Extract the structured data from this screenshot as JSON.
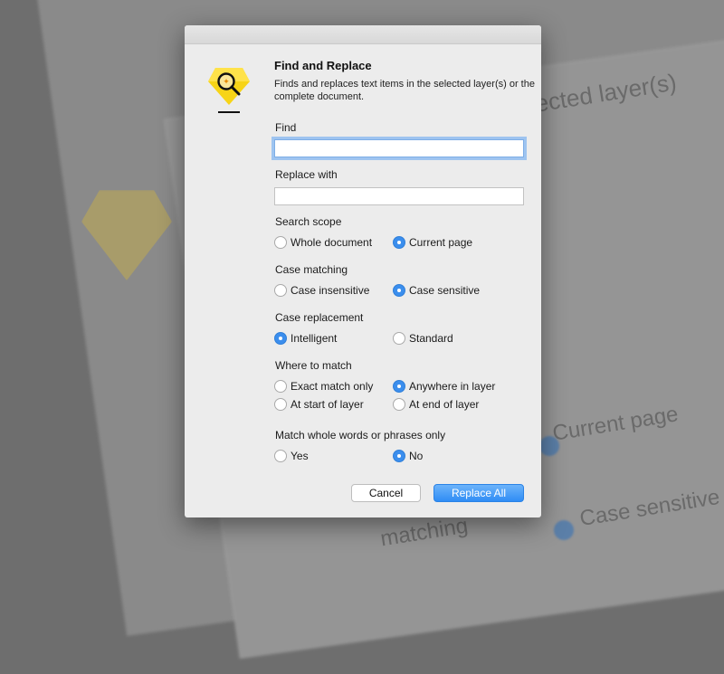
{
  "dialog": {
    "title": "Find and Replace",
    "description": "Finds and replaces text items in the selected layer(s) or the complete document.",
    "icon": "find-replace-gem-icon"
  },
  "find": {
    "label": "Find",
    "value": "",
    "placeholder": ""
  },
  "replace": {
    "label": "Replace with",
    "value": "",
    "placeholder": ""
  },
  "search_scope": {
    "label": "Search scope",
    "options": [
      "Whole document",
      "Current page"
    ],
    "selected": "Current page"
  },
  "case_matching": {
    "label": "Case matching",
    "options": [
      "Case insensitive",
      "Case sensitive"
    ],
    "selected": "Case sensitive"
  },
  "case_replacement": {
    "label": "Case replacement",
    "options": [
      "Intelligent",
      "Standard"
    ],
    "selected": "Intelligent"
  },
  "where_to_match": {
    "label": "Where to match",
    "options": [
      "Exact match only",
      "Anywhere in layer",
      "At start of layer",
      "At end of layer"
    ],
    "selected": "Anywhere in layer"
  },
  "whole_words": {
    "label": "Match whole words or phrases only",
    "options": [
      "Yes",
      "No"
    ],
    "selected": "No"
  },
  "buttons": {
    "cancel": "Cancel",
    "replace_all": "Replace All"
  },
  "background": {
    "text_1": "lected layer(s)",
    "text_2": "Current page",
    "text_3": "Case sensitive",
    "text_4": "matching"
  },
  "colors": {
    "accent": "#3b8eed",
    "logo_yellow": "#f7d417",
    "backdrop": "#6e6e6e",
    "dialog_bg": "#ececec"
  }
}
